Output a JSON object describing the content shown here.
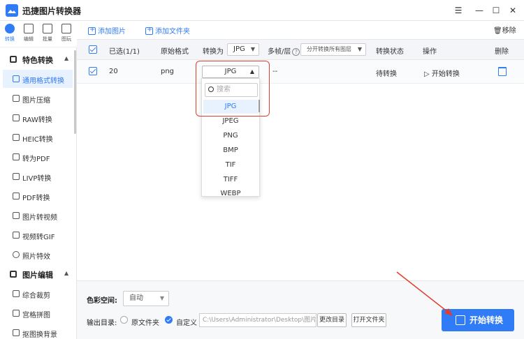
{
  "app": {
    "title": "迅捷图片转换器"
  },
  "window_controls": [
    "☰",
    "—",
    "☐",
    "✕"
  ],
  "icon_tabs": [
    {
      "label": "转换",
      "icon": "convert-icon"
    },
    {
      "label": "编辑",
      "icon": "edit-icon"
    },
    {
      "label": "批量",
      "icon": "batch-icon"
    },
    {
      "label": "图玩",
      "icon": "image-icon"
    }
  ],
  "sidebar": {
    "section1": "特色转换",
    "section1_items": [
      "通用格式转换",
      "图片压缩",
      "RAW转换",
      "HEIC转换",
      "转为PDF",
      "LIVP转换",
      "PDF转换",
      "图片转视频",
      "视频转GIF",
      "照片特效"
    ],
    "section2": "图片编辑",
    "section2_items": [
      "综合裁剪",
      "宫格拼图",
      "抠图换背景"
    ]
  },
  "toolbar": {
    "add_image": "添加图片",
    "add_folder": "添加文件夹",
    "remove": "移除"
  },
  "table": {
    "headers": {
      "selected": "已选(1/1)",
      "original_format": "原始格式",
      "convert_to": "转换为",
      "convert_to_value": "JPG",
      "frames": "多帧/层",
      "frames_value": "分开转换所有图层",
      "status": "转换状态",
      "action": "操作",
      "delete": "删除"
    },
    "rows": [
      {
        "name": "20",
        "format": "png",
        "target": "JPG",
        "frames": "--",
        "status": "待转换",
        "action": "开始转换"
      }
    ]
  },
  "dropdown": {
    "search_placeholder": "搜索",
    "options": [
      "JPG",
      "JPEG",
      "PNG",
      "BMP",
      "TIF",
      "TIFF",
      "WEBP"
    ],
    "selected": "JPG"
  },
  "bottom": {
    "color_space_label": "色彩空间:",
    "color_space_value": "自动",
    "output_dir_label": "输出目录:",
    "option_original": "原文件夹",
    "option_custom": "自定义",
    "path": "C:\\Users\\Administrator\\Desktop\\图片",
    "change_dir": "更改目录",
    "open_folder": "打开文件夹",
    "start": "开始转换"
  },
  "colors": {
    "accent": "#2f7cf6",
    "highlight": "#e03e2d"
  }
}
